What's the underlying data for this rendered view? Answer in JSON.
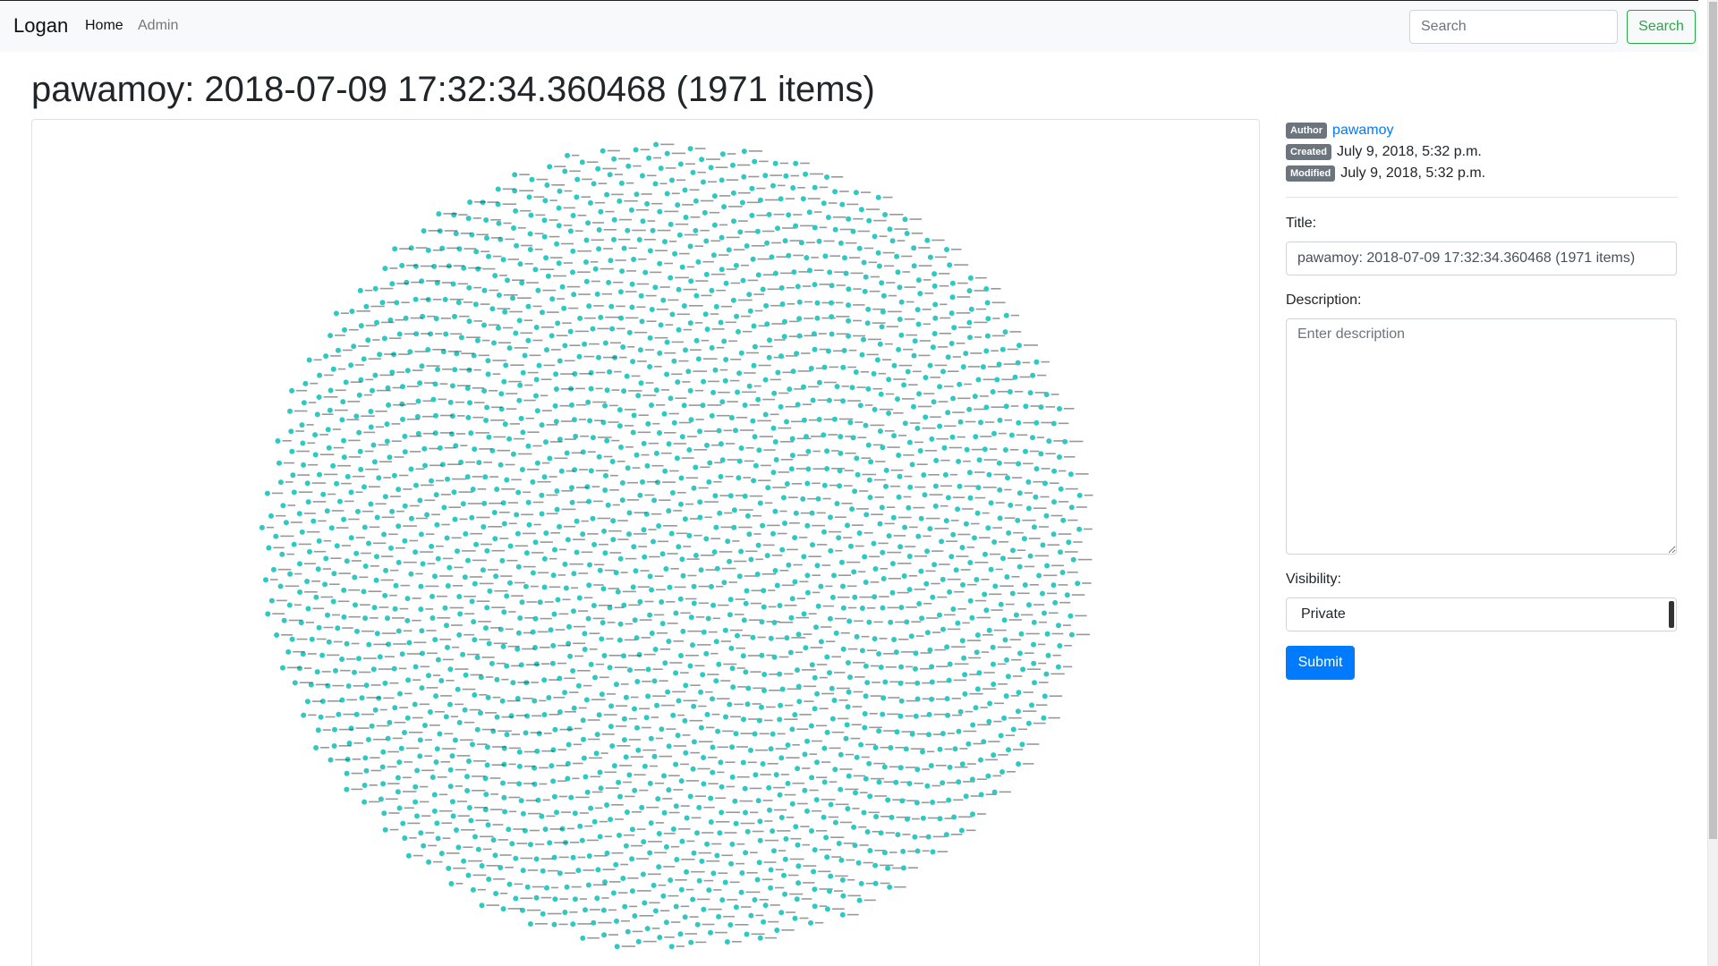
{
  "navbar": {
    "brand": "Logan",
    "links": [
      {
        "label": "Home",
        "active": true
      },
      {
        "label": "Admin",
        "active": false
      }
    ],
    "search": {
      "placeholder": "Search",
      "value": "",
      "button_label": "Search"
    }
  },
  "page": {
    "title": "pawamoy: 2018-07-09 17:32:34.360468 (1971 items)"
  },
  "graph": {
    "node_count": 1971,
    "node_color": "#2ec9c2",
    "label_color": "#444444",
    "layout": "circular"
  },
  "meta": {
    "author_badge": "Author",
    "author": "pawamoy",
    "created_badge": "Created",
    "created": "July 9, 2018, 5:32 p.m.",
    "modified_badge": "Modified",
    "modified": "July 9, 2018, 5:32 p.m."
  },
  "form": {
    "title_label": "Title:",
    "title_value": "pawamoy: 2018-07-09 17:32:34.360468 (1971 items)",
    "description_label": "Description:",
    "description_placeholder": "Enter description",
    "description_value": "",
    "visibility_label": "Visibility:",
    "visibility_value": "Private",
    "submit_label": "Submit"
  },
  "colors": {
    "primary": "#007bff",
    "success": "#28a745",
    "badge": "#6c757d"
  }
}
